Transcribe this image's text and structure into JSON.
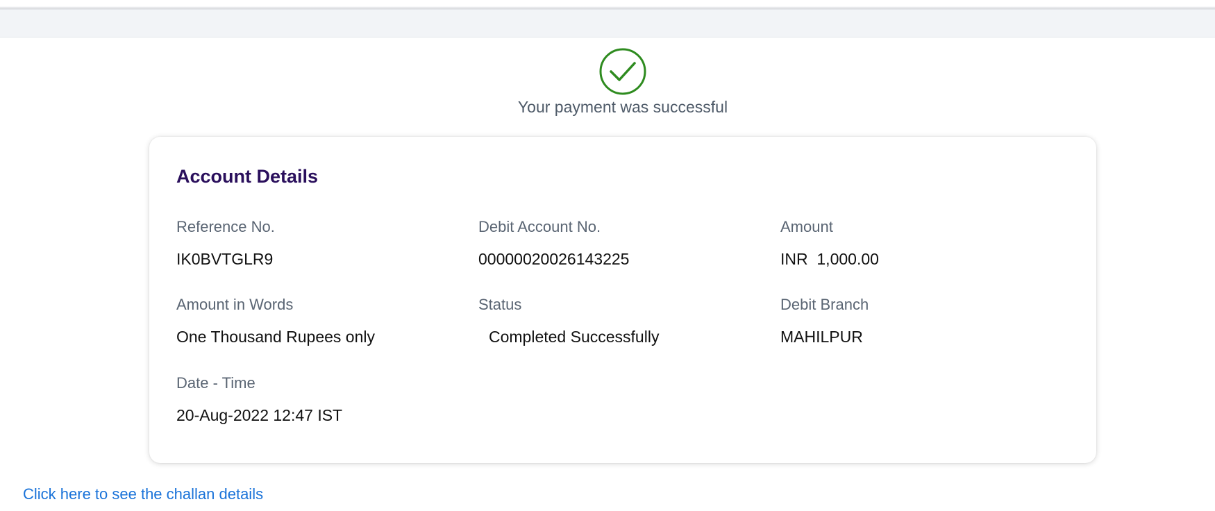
{
  "page": {
    "success_message": "Your payment was successful",
    "success_icon": "check-circle-icon",
    "success_color": "#2e8b1f"
  },
  "account_details": {
    "title": "Account Details",
    "fields": [
      {
        "label": "Reference No.",
        "value": "IK0BVTGLR9"
      },
      {
        "label": "Debit Account No.",
        "value": "00000020026143225"
      },
      {
        "label": "Amount",
        "value": "INR  1,000.00"
      },
      {
        "label": "Amount in Words",
        "value": "One Thousand Rupees only"
      },
      {
        "label": "Status",
        "value": "Completed Successfully"
      },
      {
        "label": "Debit Branch",
        "value": "MAHILPUR"
      },
      {
        "label": "Date - Time",
        "value": "20-Aug-2022 12:47 IST"
      }
    ]
  },
  "links": {
    "challan_details": "Click here to see the challan details"
  },
  "colors": {
    "title": "#2a0f5c",
    "label": "#5a6573",
    "link": "#1a73d9"
  }
}
